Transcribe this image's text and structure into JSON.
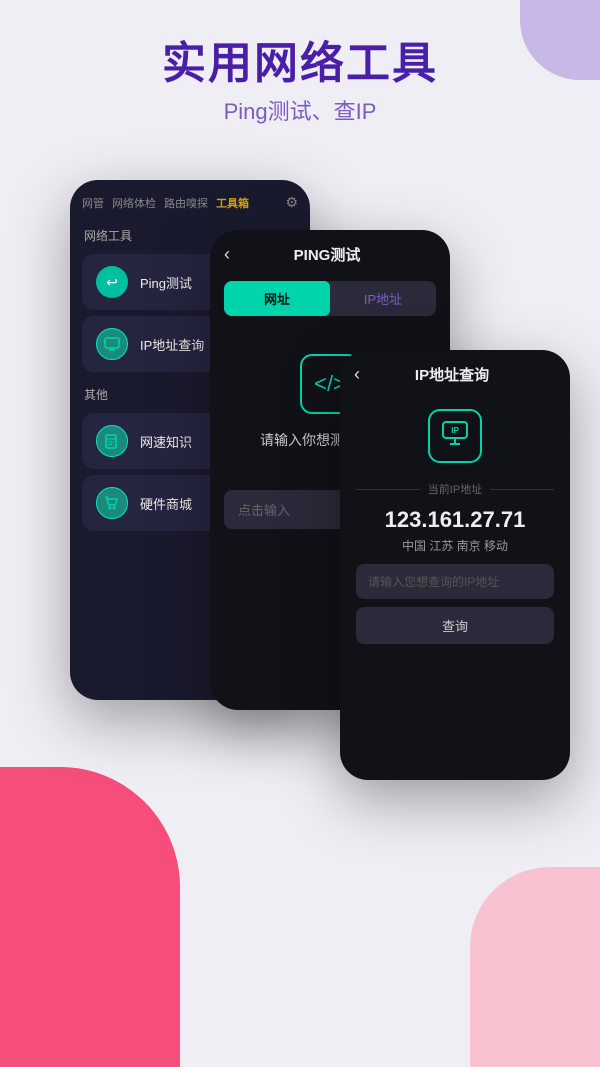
{
  "header": {
    "title": "实用网络工具",
    "subtitle": "Ping测试、查IP"
  },
  "phone1": {
    "nav": {
      "items": [
        "网管",
        "网络体检",
        "路由嗅探",
        "工具箱"
      ],
      "active_index": 3
    },
    "sections": [
      {
        "title": "网络工具",
        "items": [
          {
            "label": "Ping测试",
            "icon": "↩",
            "icon_class": "icon-teal",
            "has_arrow": true
          },
          {
            "label": "IP地址查询",
            "icon": "⊞",
            "icon_class": "icon-teal2",
            "has_arrow": false
          }
        ]
      },
      {
        "title": "其他",
        "items": [
          {
            "label": "网速知识",
            "icon": "📖",
            "icon_class": "icon-book",
            "has_arrow": false
          },
          {
            "label": "硬件商城",
            "icon": "🛍",
            "icon_class": "icon-shop",
            "has_arrow": false
          }
        ]
      }
    ]
  },
  "phone2": {
    "title": "PING测试",
    "tabs": [
      "网址",
      "IP地址"
    ],
    "active_tab": 0,
    "prompt": "请输入你想测试的网址",
    "input_placeholder": "点击输入"
  },
  "phone3": {
    "title": "IP地址查询",
    "divider_label": "当前IP地址",
    "ip_address": "123.161.27.71",
    "location": "中国 江苏 南京 移动",
    "input_placeholder": "请输入您想查询的IP地址",
    "query_btn": "查询"
  },
  "icons": {
    "back": "‹",
    "gear": "⚙",
    "arrow_right": "›",
    "code": "</>",
    "ip_icon": "IP",
    "ping_icon": "</>"
  }
}
